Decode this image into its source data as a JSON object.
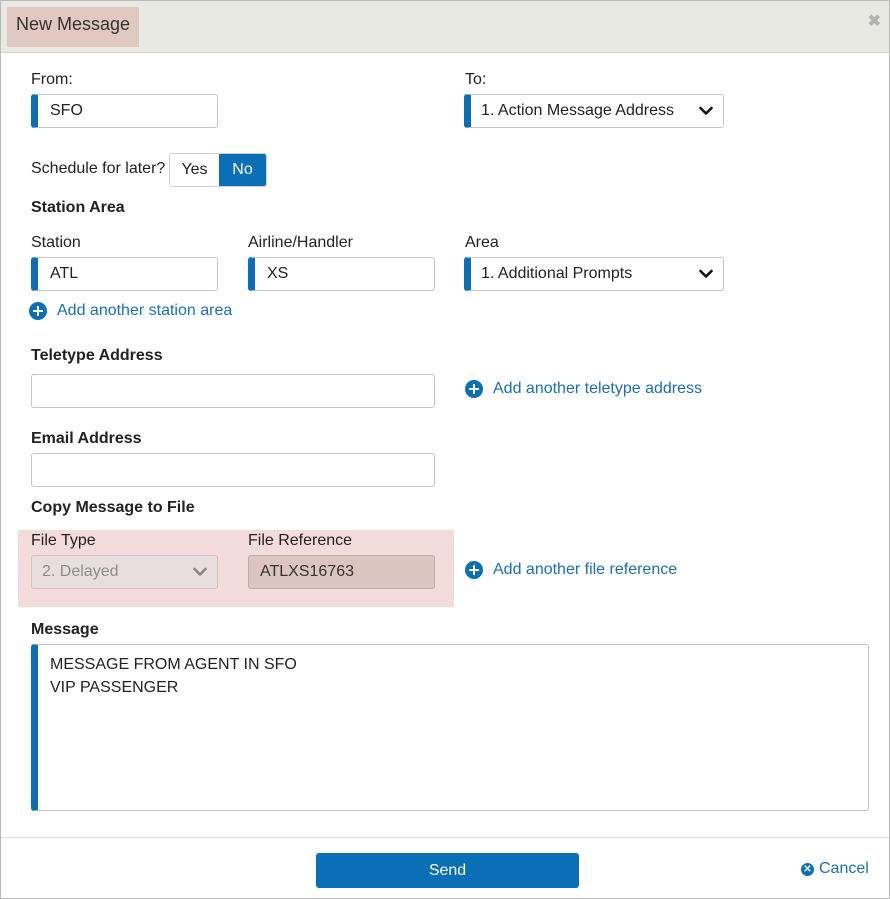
{
  "dialog": {
    "title": "New Message",
    "close_icon": "close-icon"
  },
  "from": {
    "label": "From:",
    "value": "SFO"
  },
  "to": {
    "label": "To:",
    "value": "1. Action Message Address"
  },
  "schedule": {
    "label": "Schedule for later?",
    "yes": "Yes",
    "no": "No",
    "selected": "No"
  },
  "station_area": {
    "heading": "Station Area",
    "station_label": "Station",
    "station_value": "ATL",
    "airline_label": "Airline/Handler",
    "airline_value": "XS",
    "area_label": "Area",
    "area_value": "1. Additional Prompts",
    "add_link": "Add another station area"
  },
  "teletype": {
    "heading": "Teletype Address",
    "value": "",
    "add_link": "Add another teletype address"
  },
  "email": {
    "heading": "Email Address",
    "value": ""
  },
  "copy_file": {
    "heading": "Copy Message to File",
    "file_type_label": "File Type",
    "file_type_value": "2. Delayed",
    "file_ref_label": "File Reference",
    "file_ref_value": "ATLXS16763",
    "add_link": "Add another file reference"
  },
  "message": {
    "heading": "Message",
    "text": "MESSAGE FROM AGENT IN SFO\nVIP PASSENGER"
  },
  "footer": {
    "send_label": "Send",
    "cancel_label": "Cancel"
  },
  "colors": {
    "accent": "#0b6fb8",
    "link": "#1a6fb5",
    "title_highlight": "#e1c8c0",
    "file_panel": "#f4dcdc"
  }
}
